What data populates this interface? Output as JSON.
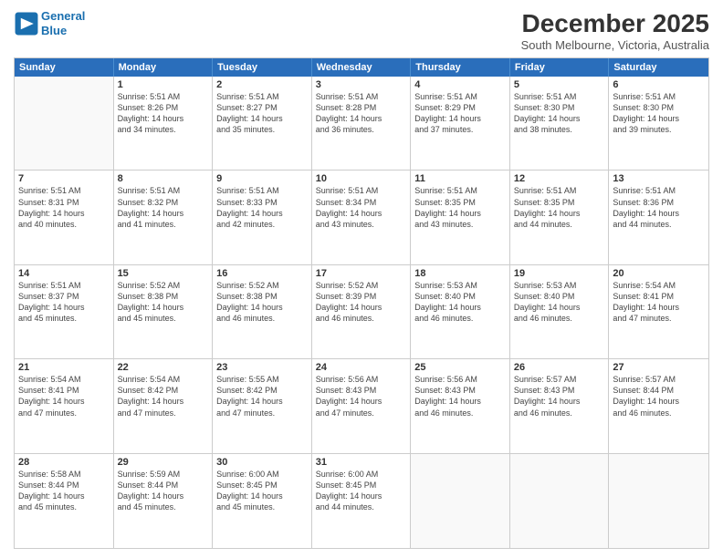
{
  "logo": {
    "line1": "General",
    "line2": "Blue",
    "icon": "▶"
  },
  "title": "December 2025",
  "subtitle": "South Melbourne, Victoria, Australia",
  "header_days": [
    "Sunday",
    "Monday",
    "Tuesday",
    "Wednesday",
    "Thursday",
    "Friday",
    "Saturday"
  ],
  "weeks": [
    [
      {
        "day": "",
        "empty": true
      },
      {
        "day": "1",
        "sunrise": "5:51 AM",
        "sunset": "8:26 PM",
        "daylight": "14 hours and 34 minutes."
      },
      {
        "day": "2",
        "sunrise": "5:51 AM",
        "sunset": "8:27 PM",
        "daylight": "14 hours and 35 minutes."
      },
      {
        "day": "3",
        "sunrise": "5:51 AM",
        "sunset": "8:28 PM",
        "daylight": "14 hours and 36 minutes."
      },
      {
        "day": "4",
        "sunrise": "5:51 AM",
        "sunset": "8:29 PM",
        "daylight": "14 hours and 37 minutes."
      },
      {
        "day": "5",
        "sunrise": "5:51 AM",
        "sunset": "8:30 PM",
        "daylight": "14 hours and 38 minutes."
      },
      {
        "day": "6",
        "sunrise": "5:51 AM",
        "sunset": "8:30 PM",
        "daylight": "14 hours and 39 minutes."
      }
    ],
    [
      {
        "day": "7",
        "sunrise": "5:51 AM",
        "sunset": "8:31 PM",
        "daylight": "14 hours and 40 minutes."
      },
      {
        "day": "8",
        "sunrise": "5:51 AM",
        "sunset": "8:32 PM",
        "daylight": "14 hours and 41 minutes."
      },
      {
        "day": "9",
        "sunrise": "5:51 AM",
        "sunset": "8:33 PM",
        "daylight": "14 hours and 42 minutes."
      },
      {
        "day": "10",
        "sunrise": "5:51 AM",
        "sunset": "8:34 PM",
        "daylight": "14 hours and 43 minutes."
      },
      {
        "day": "11",
        "sunrise": "5:51 AM",
        "sunset": "8:35 PM",
        "daylight": "14 hours and 43 minutes."
      },
      {
        "day": "12",
        "sunrise": "5:51 AM",
        "sunset": "8:35 PM",
        "daylight": "14 hours and 44 minutes."
      },
      {
        "day": "13",
        "sunrise": "5:51 AM",
        "sunset": "8:36 PM",
        "daylight": "14 hours and 44 minutes."
      }
    ],
    [
      {
        "day": "14",
        "sunrise": "5:51 AM",
        "sunset": "8:37 PM",
        "daylight": "14 hours and 45 minutes."
      },
      {
        "day": "15",
        "sunrise": "5:52 AM",
        "sunset": "8:38 PM",
        "daylight": "14 hours and 45 minutes."
      },
      {
        "day": "16",
        "sunrise": "5:52 AM",
        "sunset": "8:38 PM",
        "daylight": "14 hours and 46 minutes."
      },
      {
        "day": "17",
        "sunrise": "5:52 AM",
        "sunset": "8:39 PM",
        "daylight": "14 hours and 46 minutes."
      },
      {
        "day": "18",
        "sunrise": "5:53 AM",
        "sunset": "8:40 PM",
        "daylight": "14 hours and 46 minutes."
      },
      {
        "day": "19",
        "sunrise": "5:53 AM",
        "sunset": "8:40 PM",
        "daylight": "14 hours and 46 minutes."
      },
      {
        "day": "20",
        "sunrise": "5:54 AM",
        "sunset": "8:41 PM",
        "daylight": "14 hours and 47 minutes."
      }
    ],
    [
      {
        "day": "21",
        "sunrise": "5:54 AM",
        "sunset": "8:41 PM",
        "daylight": "14 hours and 47 minutes."
      },
      {
        "day": "22",
        "sunrise": "5:54 AM",
        "sunset": "8:42 PM",
        "daylight": "14 hours and 47 minutes."
      },
      {
        "day": "23",
        "sunrise": "5:55 AM",
        "sunset": "8:42 PM",
        "daylight": "14 hours and 47 minutes."
      },
      {
        "day": "24",
        "sunrise": "5:56 AM",
        "sunset": "8:43 PM",
        "daylight": "14 hours and 47 minutes."
      },
      {
        "day": "25",
        "sunrise": "5:56 AM",
        "sunset": "8:43 PM",
        "daylight": "14 hours and 46 minutes."
      },
      {
        "day": "26",
        "sunrise": "5:57 AM",
        "sunset": "8:43 PM",
        "daylight": "14 hours and 46 minutes."
      },
      {
        "day": "27",
        "sunrise": "5:57 AM",
        "sunset": "8:44 PM",
        "daylight": "14 hours and 46 minutes."
      }
    ],
    [
      {
        "day": "28",
        "sunrise": "5:58 AM",
        "sunset": "8:44 PM",
        "daylight": "14 hours and 45 minutes."
      },
      {
        "day": "29",
        "sunrise": "5:59 AM",
        "sunset": "8:44 PM",
        "daylight": "14 hours and 45 minutes."
      },
      {
        "day": "30",
        "sunrise": "6:00 AM",
        "sunset": "8:45 PM",
        "daylight": "14 hours and 45 minutes."
      },
      {
        "day": "31",
        "sunrise": "6:00 AM",
        "sunset": "8:45 PM",
        "daylight": "14 hours and 44 minutes."
      },
      {
        "day": "",
        "empty": true
      },
      {
        "day": "",
        "empty": true
      },
      {
        "day": "",
        "empty": true
      }
    ]
  ]
}
